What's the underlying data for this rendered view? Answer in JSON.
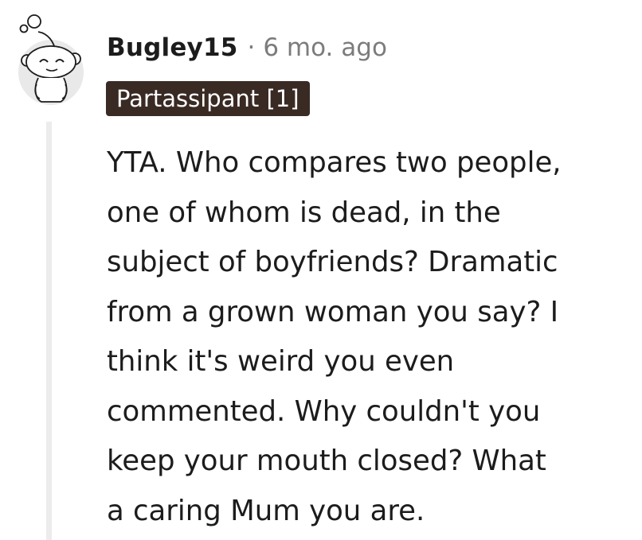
{
  "comment": {
    "author": "Bugley15",
    "separator": "·",
    "age": "6 mo. ago",
    "flair": "Partassipant [1]",
    "body": "YTA. Who compares two people,\none of whom is dead, in the\nsubject of boyfriends? Dramatic\nfrom a grown woman you say? I\nthink it's weird you even\ncommented. Why couldn't you\nkeep your mouth closed? What\na caring Mum you are."
  },
  "icons": {
    "avatar": "snoo-avatar-icon"
  },
  "colors": {
    "flair_background": "#3a2a24",
    "flair_text": "#ffffff",
    "meta_text": "#7c7c7c",
    "body_text": "#1c1c1c",
    "thread_line": "#ececec"
  }
}
